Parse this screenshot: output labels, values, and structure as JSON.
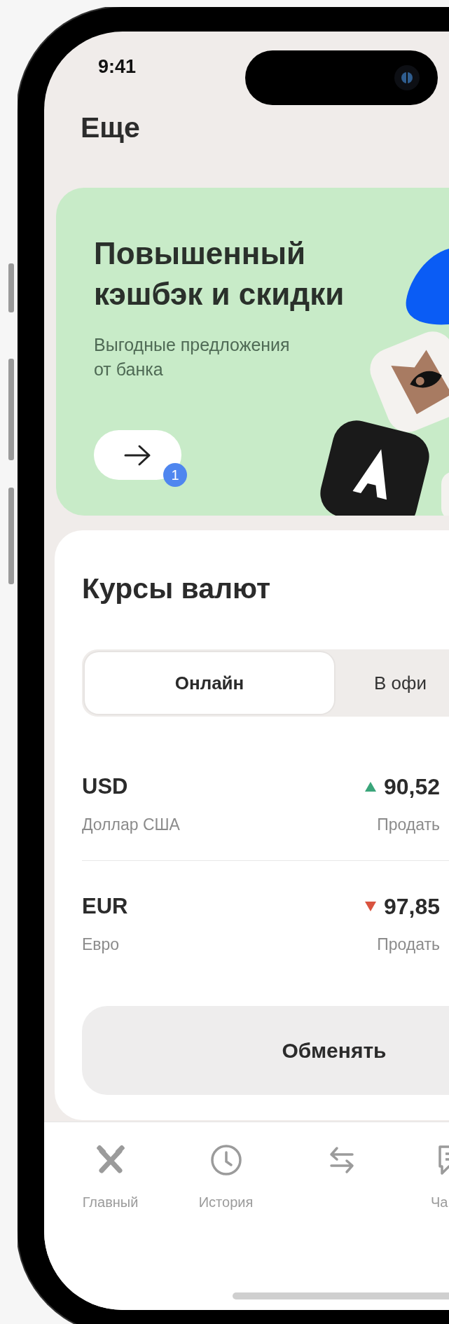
{
  "status_bar": {
    "time": "9:41"
  },
  "header": {
    "title": "Еще"
  },
  "promo": {
    "title": "Повышенный кэшбэк и скидки",
    "subtitle": "Выгодные предложения от банка",
    "badge": "1"
  },
  "rates": {
    "title": "Курсы валют",
    "tabs": [
      {
        "label": "Онлайн",
        "selected": true
      },
      {
        "label": "В офи",
        "selected": false
      }
    ],
    "rows": [
      {
        "code": "USD",
        "name": "Доллар США",
        "rising": true,
        "rate": "90,52",
        "action": "Продать"
      },
      {
        "code": "EUR",
        "name": "Евро",
        "rising": false,
        "rate": "97,85",
        "action": "Продать"
      }
    ],
    "button": "Обменять"
  },
  "tab_bar": [
    {
      "kind": "home",
      "label": "Главный",
      "selected": false
    },
    {
      "kind": "history",
      "label": "История",
      "selected": false
    },
    {
      "kind": "exchange",
      "selected": false
    },
    {
      "kind": "chat",
      "label": "Ча",
      "selected": false
    }
  ]
}
